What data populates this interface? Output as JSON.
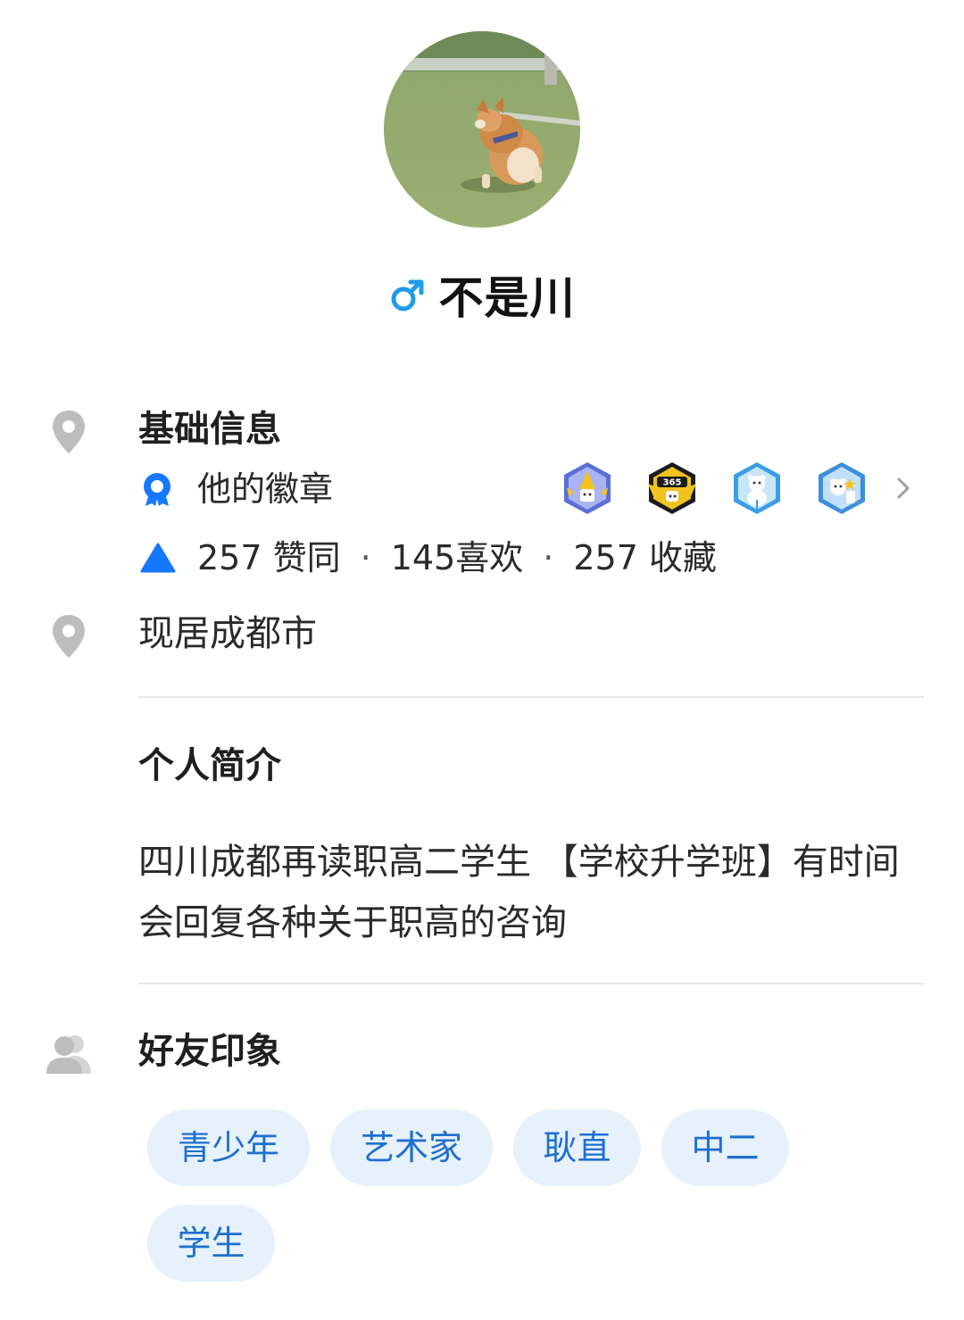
{
  "profile": {
    "name": "不是川",
    "gender_icon": "male-symbol-icon",
    "avatar": "corgi-photo"
  },
  "basic_info": {
    "title": "基础信息",
    "badges_label": "他的徽章",
    "badges": [
      "badge-yellow-hat",
      "badge-365-day",
      "badge-polar-bear",
      "badge-bear-star"
    ],
    "stats": {
      "likes": "257 赞同",
      "favorites": "145喜欢",
      "collections": "257 收藏",
      "separator": "·"
    },
    "location": "现居成都市"
  },
  "bio": {
    "title": "个人简介",
    "text": "四川成都再读职高二学生 【学校升学班】有时间会回复各种关于职高的咨询"
  },
  "friend_impressions": {
    "title": "好友印象",
    "tags": [
      "青少年",
      "艺术家",
      "耿直",
      "中二",
      "学生"
    ]
  },
  "colors": {
    "accent_blue": "#1677ff",
    "gender_blue": "#1f9be8",
    "tag_bg": "#e6f1fb",
    "tag_text": "#1f6fd0",
    "icon_gray": "#bdbdbd"
  }
}
